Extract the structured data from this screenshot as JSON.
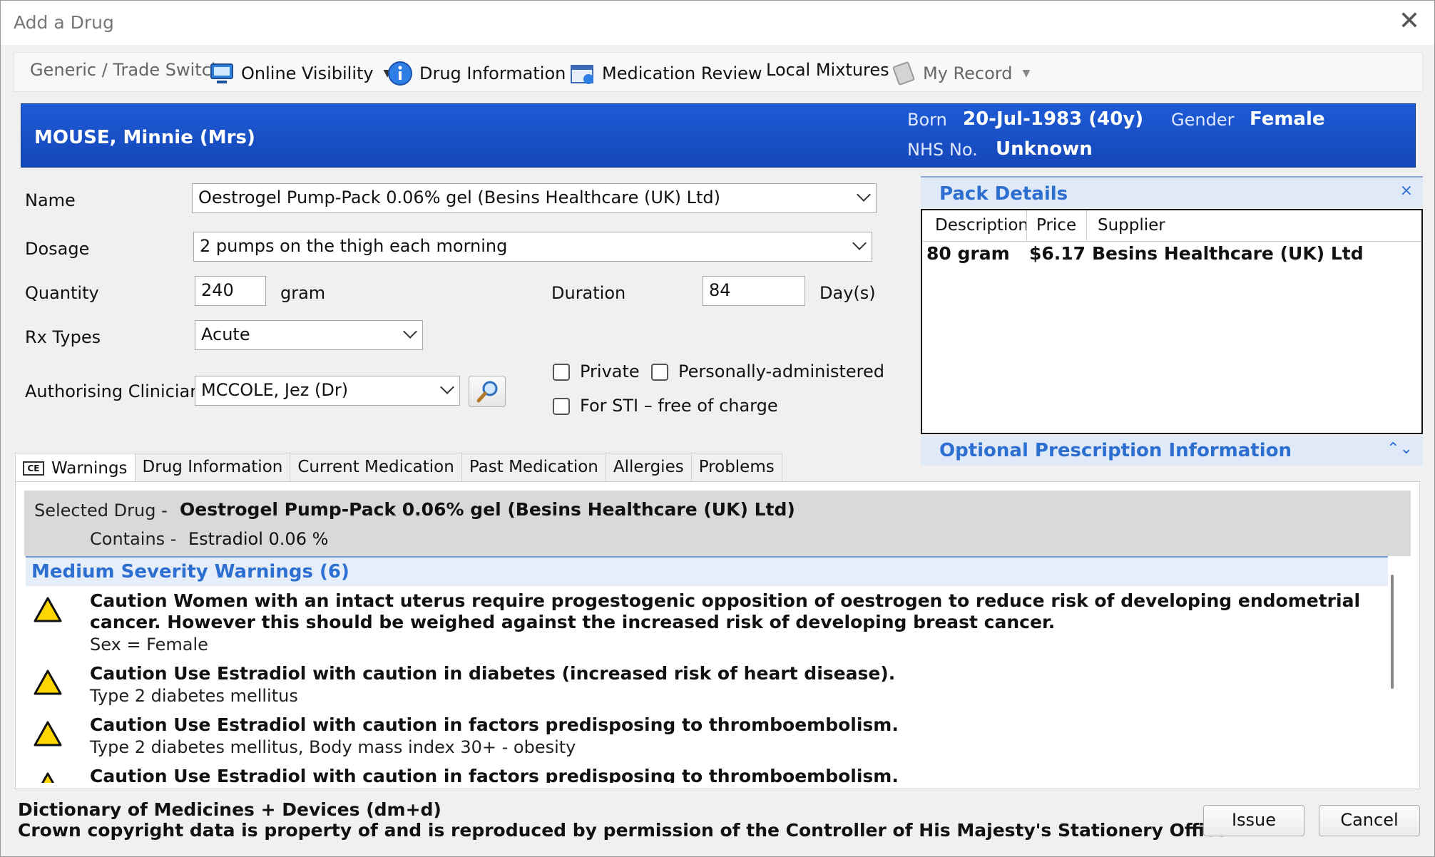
{
  "window": {
    "title": "Add a Drug"
  },
  "toolbar": {
    "generic_trade": "Generic / Trade Switch",
    "online_visibility": "Online Visibility",
    "drug_information": "Drug Information",
    "medication_review": "Medication Review",
    "local_mixtures": "Local Mixtures",
    "my_record": "My Record"
  },
  "patient": {
    "name": "MOUSE, Minnie (Mrs)",
    "born_label": "Born",
    "born_value": "20-Jul-1983 (40y)",
    "gender_label": "Gender",
    "gender_value": "Female",
    "nhs_label": "NHS No.",
    "nhs_value": "Unknown"
  },
  "form": {
    "name_label": "Name",
    "name_value": "Oestrogel Pump-Pack 0.06% gel (Besins Healthcare (UK) Ltd)",
    "dosage_label": "Dosage",
    "dosage_value": "2 pumps on the thigh each morning",
    "quantity_label": "Quantity",
    "quantity_value": "240",
    "quantity_unit": "gram",
    "duration_label": "Duration",
    "duration_value": "84",
    "duration_unit": "Day(s)",
    "rx_types_label": "Rx Types",
    "rx_types_value": "Acute",
    "clinician_label": "Authorising Clinician",
    "clinician_value": "MCCOLE, Jez (Dr)",
    "private_label": "Private",
    "personally_label": "Personally-administered",
    "sti_label": "For STI – free of charge"
  },
  "pack_details": {
    "title": "Pack Details",
    "columns": [
      "Description",
      "Price",
      "Supplier"
    ],
    "rows": [
      [
        "80 gram",
        "$6.17",
        "Besins Healthcare (UK) Ltd"
      ]
    ]
  },
  "optional_info": {
    "title": "Optional Prescription Information"
  },
  "tabs": [
    "Warnings",
    "Drug Information",
    "Current Medication",
    "Past Medication",
    "Allergies",
    "Problems"
  ],
  "selected_drug": {
    "label": "Selected Drug -",
    "value": "Oestrogel Pump-Pack 0.06% gel (Besins Healthcare (UK) Ltd)",
    "contains_label": "Contains -",
    "contains_value": "Estradiol 0.06 %"
  },
  "warnings": {
    "header": "Medium Severity Warnings (6)",
    "items": [
      {
        "text": "Caution  Women with an intact uterus require progestogenic opposition of oestrogen to reduce risk of developing endometrial cancer. However this should be weighed against the increased risk of developing breast cancer.",
        "detail": "Sex = Female"
      },
      {
        "text": "Caution  Use Estradiol with caution in diabetes (increased risk of heart disease).",
        "detail": "Type 2 diabetes mellitus"
      },
      {
        "text": "Caution  Use Estradiol with caution in factors predisposing to thromboembolism.",
        "detail": "Type 2 diabetes mellitus, Body mass index 30+ - obesity"
      },
      {
        "text": "Caution  Use Estradiol with caution in factors predisposing to thromboembolism.",
        "detail": ""
      }
    ]
  },
  "footer": {
    "line1": "Dictionary of Medicines + Devices (dm+d)",
    "line2": "Crown copyright data is property of and is reproduced by permission of the Controller of His Majesty's Stationery Office",
    "issue": "Issue",
    "cancel": "Cancel"
  }
}
